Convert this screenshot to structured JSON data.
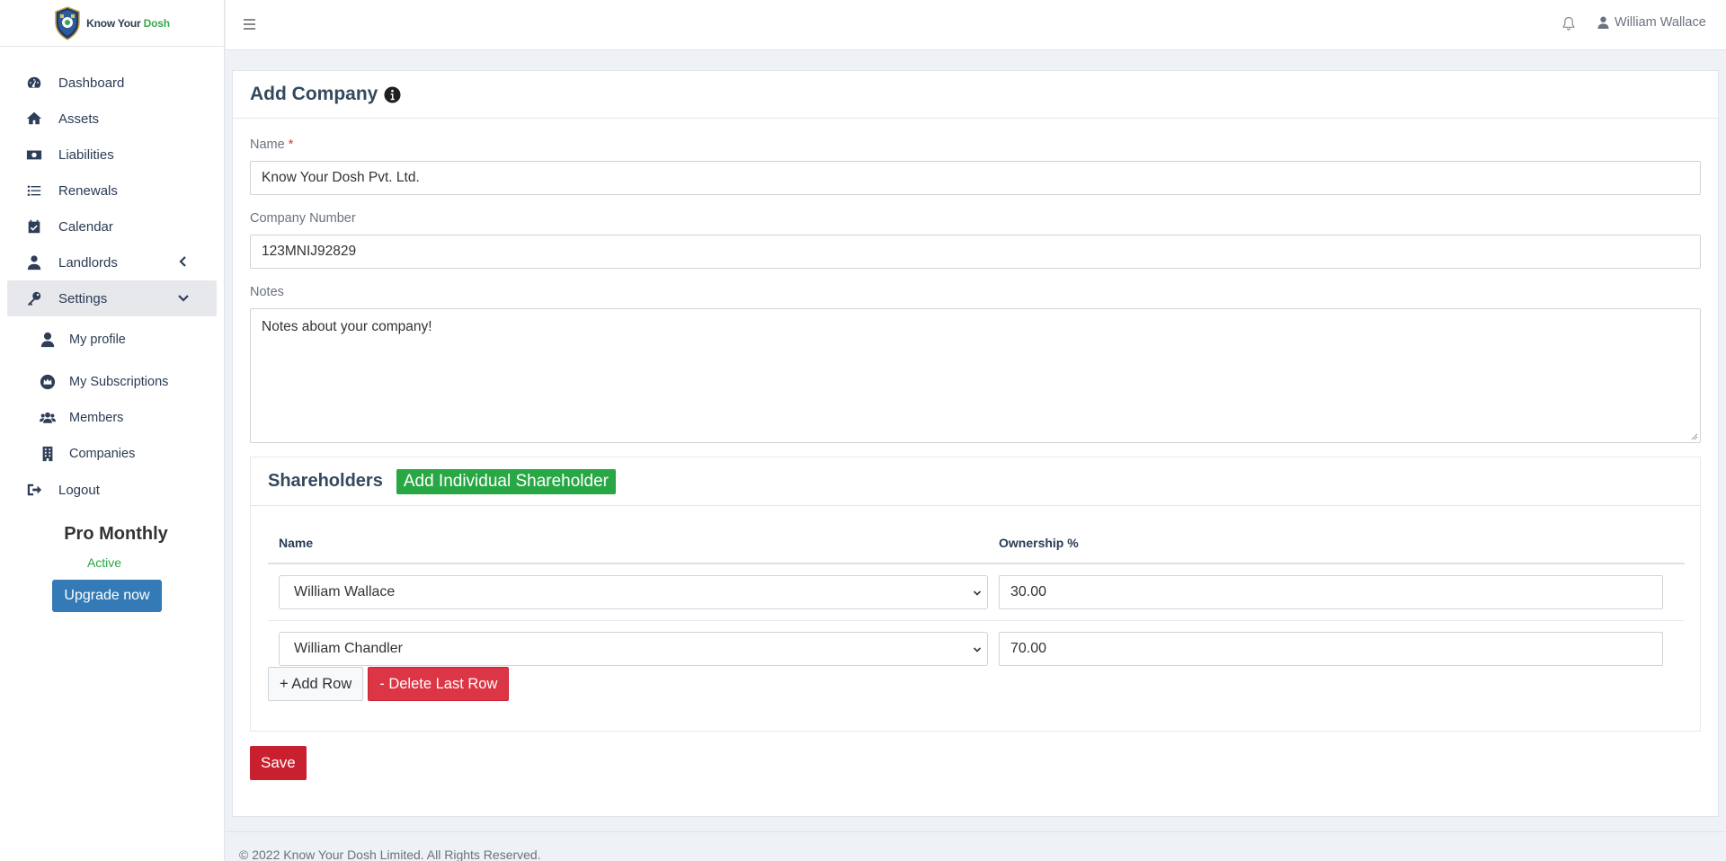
{
  "brand": {
    "name_part1": "Know Your",
    "name_part2": "Dosh"
  },
  "sidebar": {
    "items": [
      {
        "label": "Dashboard",
        "icon": "tachometer-icon"
      },
      {
        "label": "Assets",
        "icon": "home-icon"
      },
      {
        "label": "Liabilities",
        "icon": "money-bill-icon"
      },
      {
        "label": "Renewals",
        "icon": "list-icon"
      },
      {
        "label": "Calendar",
        "icon": "calendar-check-icon"
      },
      {
        "label": "Landlords",
        "icon": "user-tie-icon"
      },
      {
        "label": "Settings",
        "icon": "key-icon"
      }
    ],
    "sub_items": [
      {
        "label": "My profile",
        "icon": "user-icon"
      },
      {
        "label": "My Subscriptions",
        "icon": "crown-icon"
      },
      {
        "label": "Members",
        "icon": "users-icon"
      },
      {
        "label": "Companies",
        "icon": "building-icon"
      }
    ],
    "logout": "Logout",
    "plan": {
      "name": "Pro Monthly",
      "status": "Active",
      "upgrade_label": "Upgrade now"
    }
  },
  "topbar": {
    "user_name": "William Wallace"
  },
  "form": {
    "title": "Add Company",
    "name_label": "Name",
    "required_mark": "*",
    "name_value": "Know Your Dosh Pvt. Ltd.",
    "company_number_label": "Company Number",
    "company_number_value": "123MNIJ92829",
    "notes_label": "Notes",
    "notes_value": "Notes about your company!"
  },
  "shareholders": {
    "title": "Shareholders",
    "add_individual_label": "Add Individual Shareholder",
    "col_name": "Name",
    "col_ownership": "Ownership %",
    "rows": [
      {
        "name": "William Wallace",
        "ownership": "30.00"
      },
      {
        "name": "William Chandler",
        "ownership": "70.00"
      }
    ],
    "add_row_label": "+ Add Row",
    "delete_row_label": "- Delete Last Row"
  },
  "save_label": "Save",
  "footer": {
    "text": "© 2022 Know Your Dosh Limited. All Rights Reserved."
  },
  "colors": {
    "primary": "#337ab7",
    "success": "#28a745",
    "danger": "#dc3545",
    "save": "#c8202f"
  }
}
